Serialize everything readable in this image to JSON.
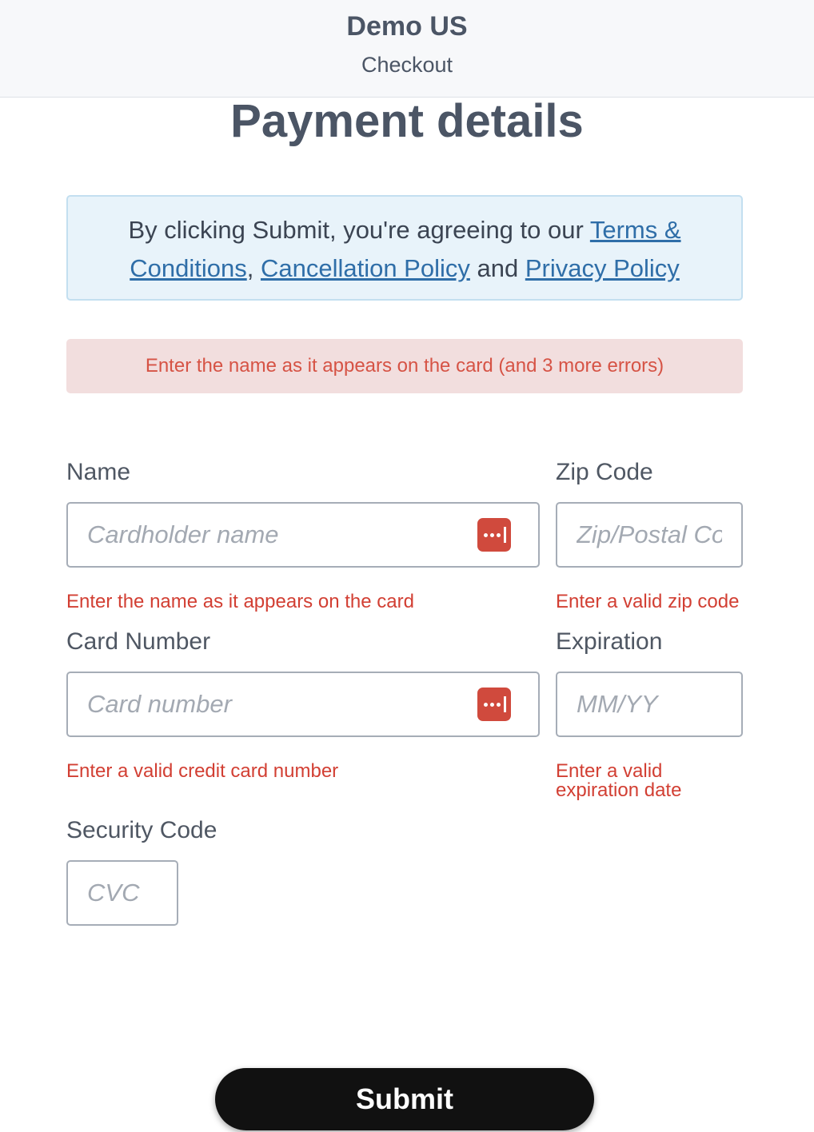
{
  "header": {
    "store_name": "Demo US",
    "subtitle": "Checkout"
  },
  "page_title": "Payment details",
  "notice": {
    "text_before": "By clicking Submit, you're agreeing to our ",
    "terms_link": "Terms & Conditions",
    "separator": ", ",
    "cancellation_link": "Cancellation Policy",
    "and_text": " and ",
    "privacy_link": "Privacy Policy"
  },
  "error_banner": "Enter the name as it appears on the card (and 3 more errors)",
  "form": {
    "name": {
      "label": "Name",
      "placeholder": "Cardholder name",
      "value": "",
      "error": "Enter the name as it appears on the card"
    },
    "zip": {
      "label": "Zip Code",
      "placeholder": "Zip/Postal Code",
      "value": "",
      "error": "Enter a valid zip code"
    },
    "card_number": {
      "label": "Card Number",
      "placeholder": "Card number",
      "value": "",
      "error": "Enter a valid credit card number"
    },
    "expiration": {
      "label": "Expiration",
      "placeholder": "MM/YY",
      "value": "",
      "error_line1": "Enter a valid",
      "error_line2": "expiration date"
    },
    "security_code": {
      "label": "Security Code",
      "placeholder": "CVC",
      "value": ""
    }
  },
  "submit_label": "Submit",
  "colors": {
    "error": "#d23f33",
    "error_bg": "#f2dede",
    "notice_bg": "#e8f3fa",
    "link": "#2f6ea8",
    "button": "#111111"
  },
  "icons": {
    "autofill": "password-manager-icon"
  }
}
